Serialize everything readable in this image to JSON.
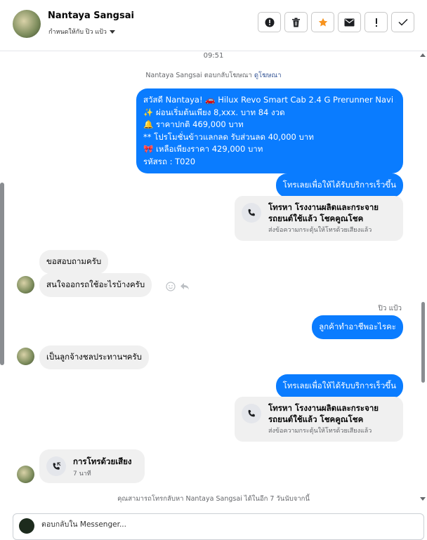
{
  "header": {
    "contact_name": "Nantaya Sangsai",
    "assign_label": "กำหนดให้กับ ปิว แป้ว",
    "actions": [
      {
        "name": "alert-circle-icon"
      },
      {
        "name": "trash-icon"
      },
      {
        "name": "star-icon",
        "color": "#f7931e"
      },
      {
        "name": "mail-icon"
      },
      {
        "name": "exclamation-icon"
      },
      {
        "name": "check-icon"
      }
    ]
  },
  "thread": {
    "timestamp": "09:51",
    "ad_reply_text": "Nantaya Sangsai ตอบกลับโฆษณา",
    "ad_link": "ดูโฆษณา",
    "promo_lines": [
      "สวัสดี Nantaya! 🚗 Hilux Revo Smart Cab 2.4 G Prerunner Navi AT",
      "✨  ผ่อนเริ่มต้นเพียง 8,xxx. บาท 84 งวด",
      "🔔 ราคาปกติ 469,000 บาท",
      "** โปรโมชั่นข้าวแลกลด รับส่วนลด 40,000 บาท",
      "🎀  เหลือเพียงราคา 429,000 บาท",
      "รหัสรถ : T020"
    ],
    "cta_label": "โทรเลยเพื่อให้ได้รับบริการเร็วขึ้น",
    "call_card": {
      "title": "โทรหา โรงงานผลิตและกระจายรถยนต์ใช้แล้ว โชคคูณโชค",
      "subtitle": "ส่งข้อความกระตุ้นให้โทรด้วยเสียงแล้ว"
    },
    "incoming_1": "ขอสอบถามครับ",
    "incoming_2": "สนใจออกรถใช้อะไรบ้างครับ",
    "sender_label": "ปิว แป้ว",
    "outgoing_1": "ลูกค้าทำอาชีพอะไรคะ",
    "incoming_3": "เป็นลูกจ้างชลประทานฯครับ",
    "voice_call": {
      "title": "การโทรด้วยเสียง",
      "time": "7 นาที"
    },
    "callback_note": "คุณสามารถโทรกลับหา Nantaya Sangsai ได้ในอีก 7 วันนับจากนี้"
  },
  "composer": {
    "placeholder": "ตอบกลับใน Messenger..."
  }
}
